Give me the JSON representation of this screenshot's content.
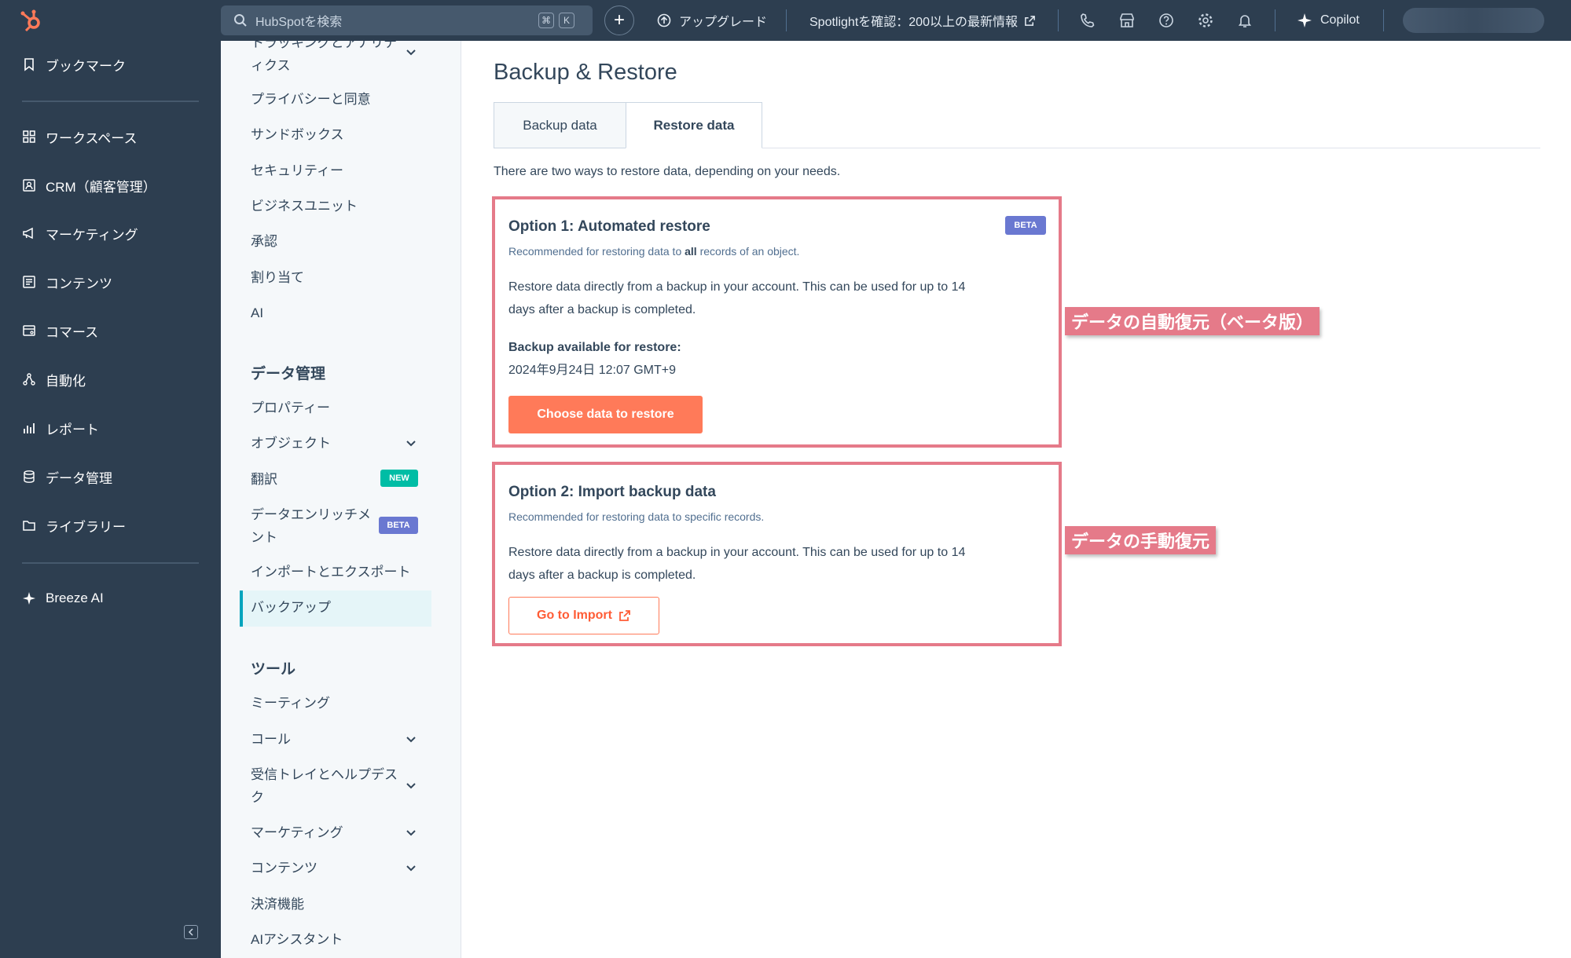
{
  "topbar": {
    "search_placeholder": "HubSpotを検索",
    "search_kbd_1": "⌘",
    "search_kbd_2": "K",
    "upgrade": "アップグレード",
    "spotlight": "Spotlightを確認：200以上の最新情報",
    "copilot": "Copilot"
  },
  "leftnav": {
    "items": [
      {
        "label": "ブックマーク",
        "icon": "bookmark-icon"
      },
      {
        "label": "ワークスペース",
        "icon": "grid-icon"
      },
      {
        "label": "CRM（顧客管理）",
        "icon": "contact-icon"
      },
      {
        "label": "マーケティング",
        "icon": "megaphone-icon"
      },
      {
        "label": "コンテンツ",
        "icon": "content-icon"
      },
      {
        "label": "コマース",
        "icon": "commerce-icon"
      },
      {
        "label": "自動化",
        "icon": "automation-icon"
      },
      {
        "label": "レポート",
        "icon": "bar-chart-icon"
      },
      {
        "label": "データ管理",
        "icon": "database-icon"
      },
      {
        "label": "ライブラリー",
        "icon": "folder-icon"
      },
      {
        "label": "Breeze AI",
        "icon": "sparkle-icon"
      }
    ]
  },
  "subnav": {
    "truncated_top_line1": "トラッキングとアナリテ",
    "truncated_top_line2": "ィクス",
    "items_top": [
      "プライバシーと同意",
      "サンドボックス",
      "セキュリティー",
      "ビジネスユニット",
      "承認",
      "割り当て",
      "AI"
    ],
    "section_data": "データ管理",
    "data_items": {
      "properties": "プロパティー",
      "objects": "オブジェクト",
      "translation": "翻訳",
      "translation_badge": "NEW",
      "enrichment_line1": "データエンリッチメ",
      "enrichment_line2": "ント",
      "enrichment_badge": "BETA",
      "import_export": "インポートとエクスポート",
      "backup": "バックアップ"
    },
    "section_tools": "ツール",
    "tool_items": {
      "meetings": "ミーティング",
      "calls": "コール",
      "inbox_line1": "受信トレイとヘルプデス",
      "inbox_line2": "ク",
      "marketing": "マーケティング",
      "content": "コンテンツ",
      "payments": "決済機能",
      "ai_assistant": "AIアシスタント"
    }
  },
  "main": {
    "title": "Backup & Restore",
    "tabs": [
      {
        "label": "Backup data",
        "active": false
      },
      {
        "label": "Restore data",
        "active": true
      }
    ],
    "intro": "There are two ways to restore data, depending on your needs.",
    "option1": {
      "title": "Option 1: Automated restore",
      "badge": "BETA",
      "sub_pre": "Recommended for restoring data to ",
      "sub_bold": "all",
      "sub_post": " records of an object.",
      "body_line1": "Restore data directly from a backup in your account. This can be used for up to 14",
      "body_line2": "days after a backup is completed.",
      "available_label": "Backup available for restore:",
      "available_value": "2024年9月24日 12:07 GMT+9",
      "button": "Choose data to restore"
    },
    "option2": {
      "title": "Option 2: Import backup data",
      "sub": "Recommended for restoring data to specific records.",
      "body_line1": "Restore data directly from a backup in your account. This can be used for up to 14",
      "body_line2": "days after a backup is completed.",
      "button": "Go to Import"
    }
  },
  "callouts": {
    "auto": "データの自動復元（ベータ版）",
    "manual": "データの手動復元"
  },
  "colors": {
    "nav_bg": "#2d3e50",
    "accent_orange": "#ff7a59",
    "highlight_pink": "#e57a89",
    "active_teal": "#00a4bd",
    "beta_purple": "#6a78d1",
    "new_green": "#00bda5"
  }
}
